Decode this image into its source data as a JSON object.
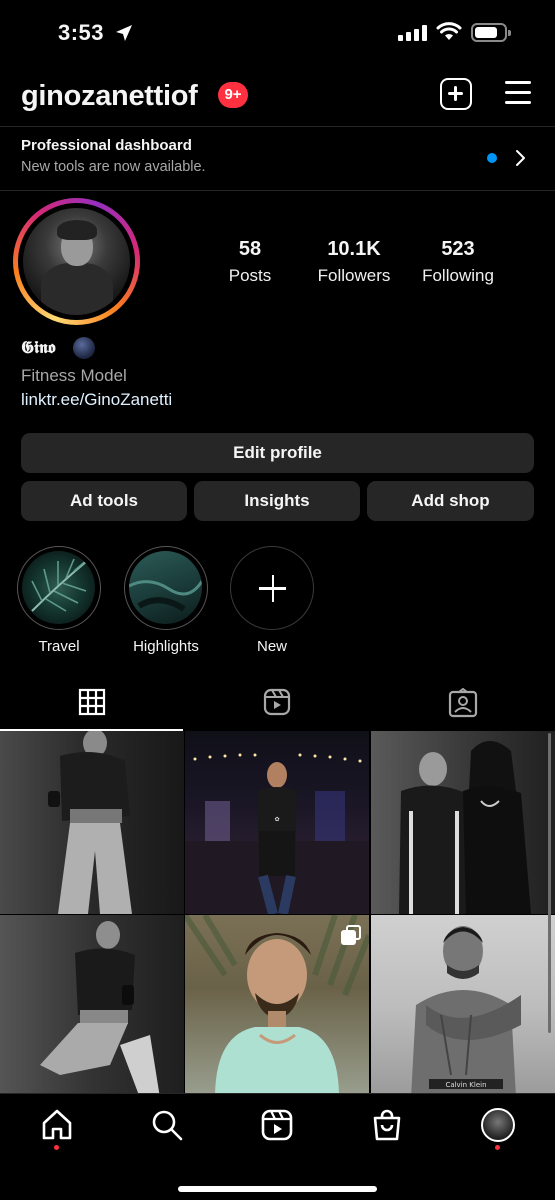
{
  "status_bar": {
    "time": "3:53"
  },
  "header": {
    "username": "ginozanettiof",
    "notification_badge": "9+"
  },
  "pro_dashboard": {
    "title": "Professional dashboard",
    "subtitle": "New tools are now available."
  },
  "profile": {
    "stats": [
      {
        "value": "58",
        "label": "Posts"
      },
      {
        "value": "10.1K",
        "label": "Followers"
      },
      {
        "value": "523",
        "label": "Following"
      }
    ],
    "display_name": "𝕲𝖎𝖓𝖔",
    "bio": "Fitness Model",
    "link": "linktr.ee/GinoZanetti"
  },
  "buttons": {
    "edit_profile": "Edit profile",
    "ad_tools": "Ad tools",
    "insights": "Insights",
    "add_shop": "Add shop"
  },
  "highlights": [
    {
      "label": "Travel"
    },
    {
      "label": "Highlights"
    },
    {
      "label": "New"
    }
  ],
  "tabs": [
    {
      "icon": "grid-icon",
      "active": true
    },
    {
      "icon": "reels-icon",
      "active": false
    },
    {
      "icon": "tagged-icon",
      "active": false
    }
  ],
  "colors": {
    "background": "#000000",
    "button_bg": "#262626",
    "badge_red": "#ff3040",
    "accent_blue": "#0095f6",
    "secondary_text": "#a8a8a8"
  },
  "nav": [
    "home-icon",
    "search-icon",
    "reels-icon",
    "shop-icon",
    "profile-avatar"
  ]
}
